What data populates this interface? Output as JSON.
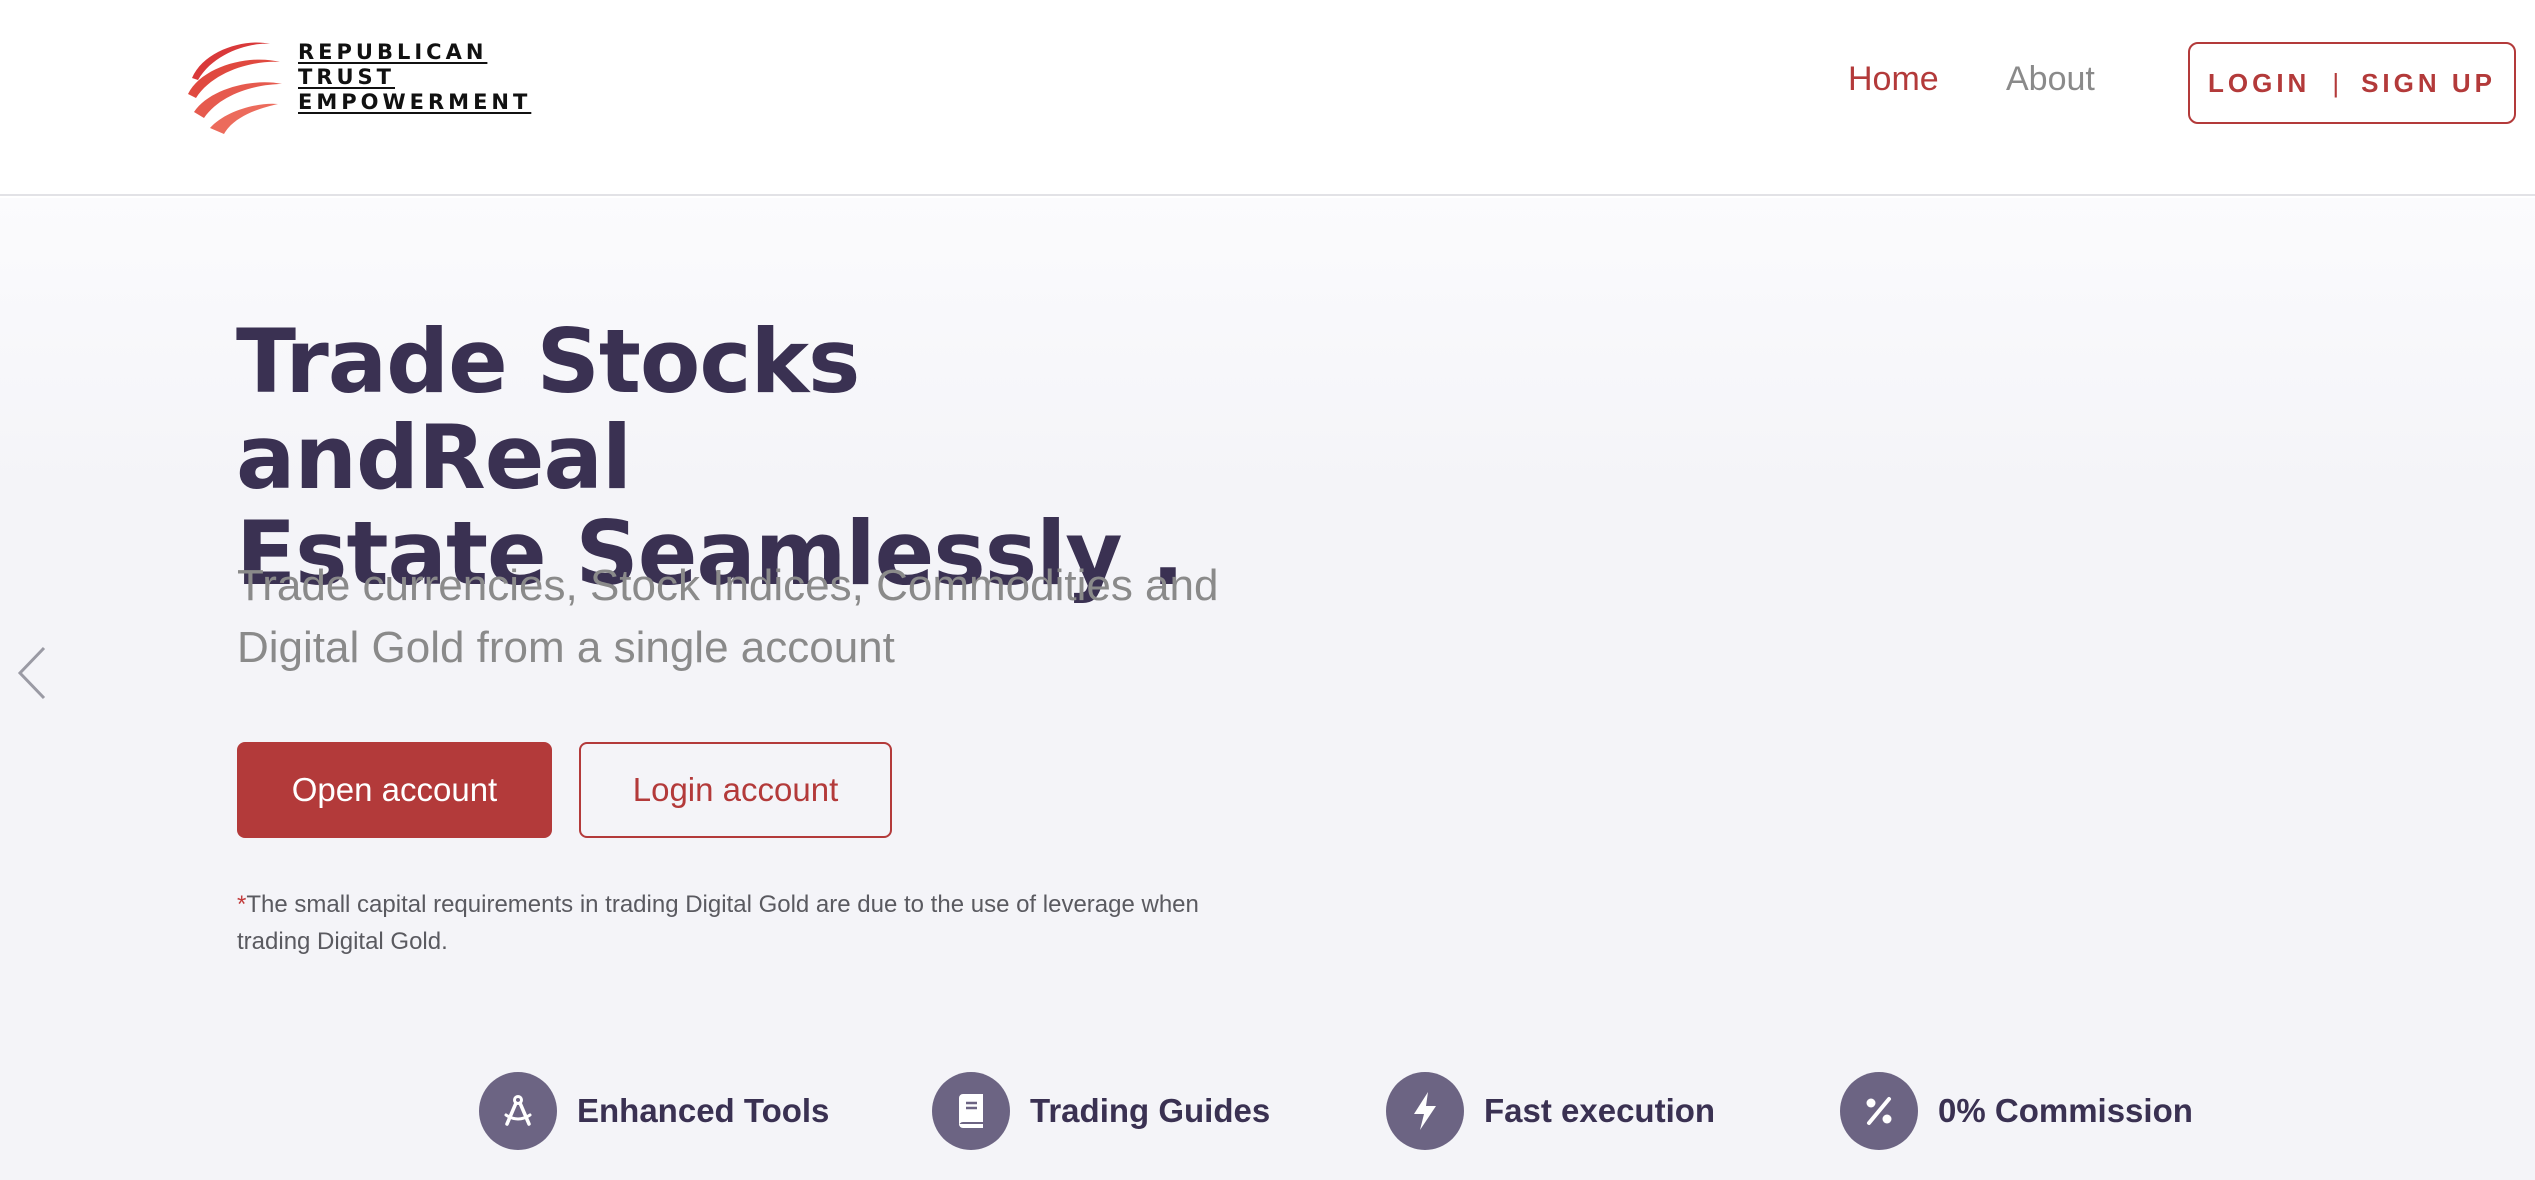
{
  "header": {
    "logo_lines": [
      "REPUBLICAN",
      "TRUST",
      "EMPOWERMENT"
    ],
    "nav": [
      {
        "label": "Home",
        "active": true
      },
      {
        "label": "About",
        "active": false
      }
    ],
    "auth": {
      "login": "LOGIN",
      "separator": "|",
      "signup": "SIGN UP"
    }
  },
  "hero": {
    "headline_line1": "Trade Stocks andReal",
    "headline_line2": "Estate Seamlessly .",
    "subtext_line1": "Trade currencies, Stock Indices, Commodities and",
    "subtext_line2": "Digital Gold from a single account",
    "primary_button": "Open account",
    "secondary_button": "Login account",
    "disclaimer_mark": "*",
    "disclaimer_line1": "The small capital requirements in trading Digital Gold are due to the use of leverage when",
    "disclaimer_line2": "trading Digital Gold."
  },
  "features": [
    {
      "label": "Enhanced Tools",
      "icon": "compass-icon"
    },
    {
      "label": "Trading Guides",
      "icon": "book-icon"
    },
    {
      "label": "Fast execution",
      "icon": "lightning-icon"
    },
    {
      "label": "0% Commission",
      "icon": "percent-icon"
    }
  ],
  "colors": {
    "accent": "#b33a3a",
    "heading": "#3a3152",
    "icon_bg": "#6c6483",
    "muted": "#8a8a8a",
    "hero_bg": "#f4f4f8"
  }
}
